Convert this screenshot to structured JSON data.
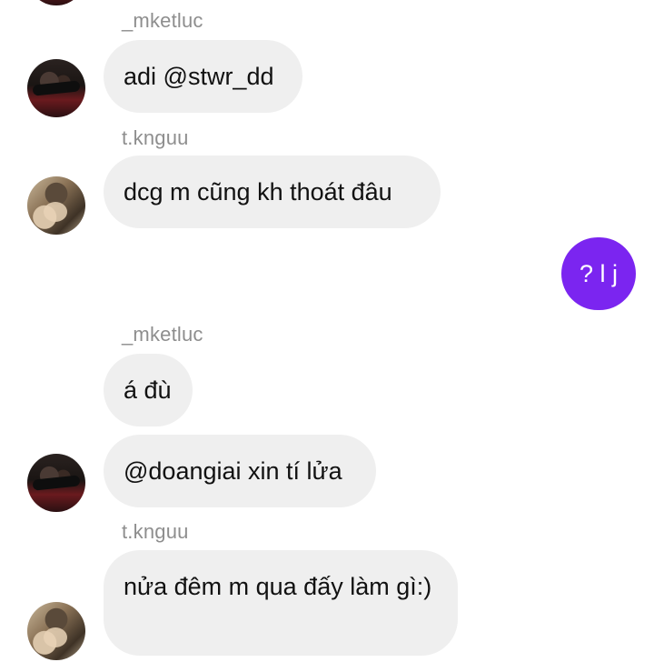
{
  "messages": [
    {
      "sender": "_mketluc",
      "texts": [
        "adi @stwr_dd"
      ]
    },
    {
      "sender": "t.knguu",
      "texts": [
        "dcg m cũng kh thoát đâu"
      ]
    },
    {
      "mine": "? l j"
    },
    {
      "sender": "_mketluc",
      "texts": [
        "á đù",
        "@doangiai xin tí lửa"
      ]
    },
    {
      "sender": "t.knguu",
      "texts": [
        "nửa đêm m qua đấy làm gì:)"
      ]
    }
  ],
  "colors": {
    "bubble_other": "#efefef",
    "bubble_mine": "#7b25f0",
    "sender_text": "#8e8e8e"
  }
}
